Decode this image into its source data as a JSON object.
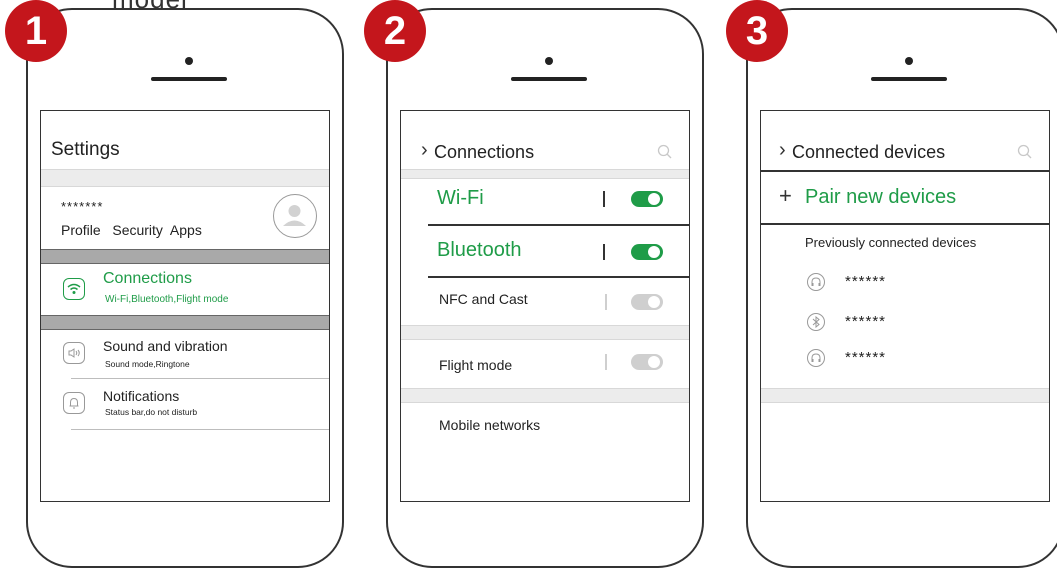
{
  "caption_top": "model",
  "steps": [
    {
      "number": "1"
    },
    {
      "number": "2"
    },
    {
      "number": "3"
    }
  ],
  "phone1": {
    "title": "Settings",
    "profile_mask": "*******",
    "profile_links": "Profile   Security  Apps",
    "connections": {
      "label": "Connections",
      "sub": "Wi-Fi,Bluetooth,Flight mode"
    },
    "sound": {
      "label": "Sound and vibration",
      "sub": "Sound mode,Ringtone"
    },
    "notifications": {
      "label": "Notifications",
      "sub": "Status bar,do not disturb"
    }
  },
  "phone2": {
    "title": "Connections",
    "items": [
      {
        "label": "Wi-Fi",
        "on": true
      },
      {
        "label": "Bluetooth",
        "on": true
      },
      {
        "label": "NFC and Cast",
        "on": false
      },
      {
        "label": "Flight mode",
        "on": false
      },
      {
        "label": "Mobile networks"
      }
    ]
  },
  "phone3": {
    "title": "Connected devices",
    "pair": "Pair new devices",
    "previous": "Previously connected devices",
    "devices": [
      {
        "icon": "headphones-icon",
        "name": "******"
      },
      {
        "icon": "bluetooth-icon",
        "name": "******"
      },
      {
        "icon": "headphones-icon",
        "name": "******"
      }
    ]
  },
  "colors": {
    "accent": "#1f9c48",
    "badge": "#c4161c"
  }
}
